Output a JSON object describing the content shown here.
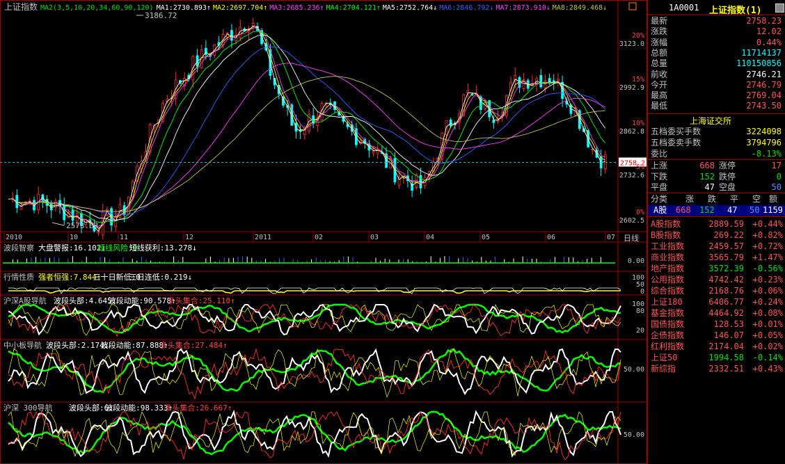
{
  "main": {
    "title": "上证指数",
    "ma_labels": [
      {
        "text": "MA2(3,5,10,20,34,60,90,120)",
        "color": "#00e000"
      },
      {
        "text": "MA1:2730.893↑",
        "color": "#ffffff"
      },
      {
        "text": "MA2:2697.704↑",
        "color": "#ffff00"
      },
      {
        "text": "MA3:2685.236↑",
        "color": "#ff40ff"
      },
      {
        "text": "MA4:2704.121↑",
        "color": "#00ff00"
      },
      {
        "text": "MA5:2752.764↓",
        "color": "#ffffff"
      },
      {
        "text": "MA6:2846.792↓",
        "color": "#3060ff"
      },
      {
        "text": "MA7:2873.910↓",
        "color": "#ff40ff"
      },
      {
        "text": "MA8:2849.468↓",
        "color": "#c0c050"
      }
    ],
    "high_label": "3186.72",
    "low_label": "2573.63",
    "price_marker": "2758.2",
    "right_axis": [
      {
        "price": "3123.0",
        "pct": "20%"
      },
      {
        "price": "2992.9",
        "pct": "15%"
      },
      {
        "price": "2862.8",
        "pct": "10%"
      },
      {
        "price": "2732.6",
        "pct": "5%"
      },
      {
        "price": "2602.5",
        "pct": "0%"
      }
    ],
    "months": [
      "2010",
      "10",
      "11",
      "12",
      "2011",
      "02",
      "03",
      "04",
      "05",
      "06",
      "07"
    ],
    "period_label": "日线"
  },
  "panels": [
    {
      "title": "波段智察",
      "items": [
        {
          "text": "大盘警报:16.102↓",
          "color": "#ffffff"
        },
        {
          "text": "短线风险:0",
          "color": "#00ff00"
        },
        {
          "text": "短线获利:13.278↓",
          "color": "#ffffff"
        }
      ],
      "axis": [
        "0.00"
      ]
    },
    {
      "title": "行情性质",
      "items": [
        {
          "text": "强者恒强:7.844↑",
          "color": "#ffff00"
        },
        {
          "text": "三十日新低:0",
          "color": "#ffffff"
        },
        {
          "text": "三日连低:0.219↓",
          "color": "#ffffff"
        }
      ],
      "axis": [
        "100",
        "50",
        "0"
      ]
    },
    {
      "title": "沪深A股导航",
      "items": [
        {
          "text": "波段头部:4.645↓",
          "color": "#ffffff"
        },
        {
          "text": "波段动能:90.578↑",
          "color": "#ffffff"
        },
        {
          "text": "多头集合:25.110↑",
          "color": "#ff4040"
        }
      ],
      "axis": [
        "100",
        "80",
        "20"
      ]
    },
    {
      "title": "中小板导航",
      "items": [
        {
          "text": "波段头部:2.174↓",
          "color": "#ffffff"
        },
        {
          "text": "波段动能:87.888↑",
          "color": "#ffffff"
        },
        {
          "text": "多头集合:27.484↑",
          "color": "#ff4040"
        }
      ],
      "axis": [
        "50.00"
      ]
    },
    {
      "title": "沪深 300导航",
      "items": [
        {
          "text": "波段头部:6↓",
          "color": "#ffffff"
        },
        {
          "text": "波段动能:98.333↑",
          "color": "#ffffff"
        },
        {
          "text": "多头集合:26.667↑",
          "color": "#ff4040"
        }
      ],
      "axis": [
        "50.00"
      ]
    }
  ],
  "quote": {
    "code": "1A0001",
    "name": "上证指数(1)",
    "rows": [
      {
        "label": "最新",
        "value": "2758.23",
        "color": "red"
      },
      {
        "label": "涨跌",
        "value": "12.02",
        "color": "red"
      },
      {
        "label": "涨幅",
        "value": "0.44%",
        "color": "red"
      },
      {
        "label": "总额",
        "value": "11714137",
        "color": "cyan"
      },
      {
        "label": "总量",
        "value": "110150856",
        "color": "cyan"
      },
      {
        "label": "前收",
        "value": "2746.21",
        "color": "white"
      },
      {
        "label": "今开",
        "value": "2746.79",
        "color": "red"
      },
      {
        "label": "最高",
        "value": "2769.04",
        "color": "red"
      },
      {
        "label": "最低",
        "value": "2743.50",
        "color": "red"
      }
    ],
    "exchange": "上海证交所",
    "orders": [
      {
        "label": "五档委买手数",
        "value": "3224098",
        "color": "yel"
      },
      {
        "label": "五档委卖手数",
        "value": "3794796",
        "color": "yel"
      },
      {
        "label": "委比",
        "value": "-8.13%",
        "color": "grn"
      }
    ],
    "breadth": [
      {
        "l1": "上涨",
        "v1": "668",
        "c1": "red",
        "l2": "涨停",
        "v2": "17",
        "c2": "red"
      },
      {
        "l1": "下跌",
        "v1": "152",
        "c1": "grn",
        "l2": "跌停",
        "v2": "0",
        "c2": "grn"
      },
      {
        "l1": "平盘",
        "v1": "47",
        "c1": "white",
        "l2": "空盘",
        "v2": "50",
        "c2": "blue"
      }
    ],
    "class_header": [
      "分类",
      "涨",
      "跌",
      "平",
      "空",
      "额"
    ],
    "class_row": {
      "name": "A股",
      "up": "668",
      "down": "152",
      "flat": "47",
      "empty": "50",
      "amount": "1159"
    },
    "indices": [
      {
        "name": "A股指数",
        "value": "2889.59",
        "chg": "+0.44%",
        "color": "red"
      },
      {
        "name": "B股指数",
        "value": "269.22",
        "chg": "+0.82%",
        "color": "red"
      },
      {
        "name": "工业指数",
        "value": "2459.57",
        "chg": "+0.72%",
        "color": "red"
      },
      {
        "name": "商业指数",
        "value": "3565.79",
        "chg": "+1.47%",
        "color": "red"
      },
      {
        "name": "地产指数",
        "value": "3572.39",
        "chg": "-0.56%",
        "color": "grn"
      },
      {
        "name": "公用指数",
        "value": "4742.42",
        "chg": "+0.23%",
        "color": "red"
      },
      {
        "name": "综合指数",
        "value": "2168.76",
        "chg": "+0.06%",
        "color": "red"
      },
      {
        "name": "上证180",
        "value": "6406.77",
        "chg": "+0.24%",
        "color": "red"
      },
      {
        "name": "基金指数",
        "value": "4464.92",
        "chg": "+0.08%",
        "color": "red"
      },
      {
        "name": "国债指数",
        "value": "128.53",
        "chg": "+0.01%",
        "color": "red"
      },
      {
        "name": "企债指数",
        "value": "146.07",
        "chg": "+0.05%",
        "color": "red"
      },
      {
        "name": "红利指数",
        "value": "2174.04",
        "chg": "+0.02%",
        "color": "red"
      },
      {
        "name": "上证50",
        "value": "1994.58",
        "chg": "-0.14%",
        "color": "grn"
      },
      {
        "name": "新综指",
        "value": "2332.51",
        "chg": "+0.43%",
        "color": "red"
      }
    ]
  }
}
